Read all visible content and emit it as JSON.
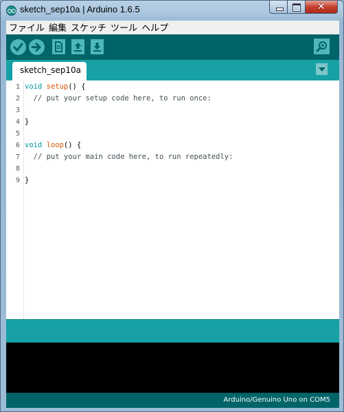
{
  "window": {
    "title": "sketch_sep10a | Arduino 1.6.5"
  },
  "menu": [
    {
      "label": "ファイル"
    },
    {
      "label": "編集"
    },
    {
      "label": "スケッチ"
    },
    {
      "label": "ツール"
    },
    {
      "label": "ヘルプ"
    }
  ],
  "toolbar": {
    "buttons": [
      "check-icon",
      "arrow-right-icon",
      "new-file-icon",
      "upload-arrow-icon",
      "download-arrow-icon"
    ],
    "serial_monitor": "magnifier-icon",
    "accent_color": "#006468",
    "button_color": "#4db7bb"
  },
  "tabs": [
    {
      "label": "sketch_sep10a"
    }
  ],
  "editor": {
    "line_numbers": [
      "1",
      "2",
      "3",
      "4",
      "5",
      "6",
      "7",
      "8",
      "9"
    ],
    "lines": [
      {
        "kw": "void",
        "fn": "setup",
        "rest": "() {"
      },
      {
        "text": "  // put your setup code here, to run once:"
      },
      {
        "text": ""
      },
      {
        "text": "}"
      },
      {
        "text": ""
      },
      {
        "kw": "void",
        "fn": "loop",
        "rest": "() {"
      },
      {
        "text": "  // put your main code here, to run repeatedly:"
      },
      {
        "text": ""
      },
      {
        "text": "}"
      }
    ]
  },
  "status": {
    "board": "Arduino/Genuino Uno on COM5"
  }
}
